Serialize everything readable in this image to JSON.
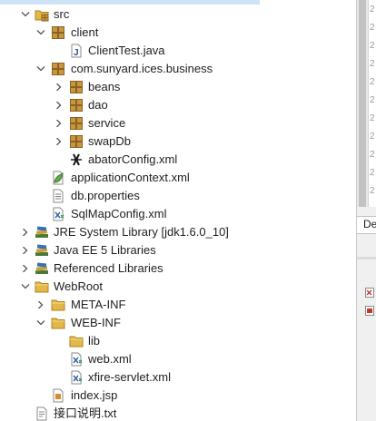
{
  "explorer": {
    "items": [
      {
        "label": "src",
        "depth": 1,
        "icon": "source-folder-icon",
        "expanded": true
      },
      {
        "label": "client",
        "depth": 2,
        "icon": "package-icon",
        "expanded": true
      },
      {
        "label": "ClientTest.java",
        "depth": 3,
        "icon": "java-file-icon"
      },
      {
        "label": "com.sunyard.ices.business",
        "depth": 2,
        "icon": "package-icon",
        "expanded": true
      },
      {
        "label": "beans",
        "depth": 3,
        "icon": "package-icon",
        "expanded": false
      },
      {
        "label": "dao",
        "depth": 3,
        "icon": "package-icon",
        "expanded": false
      },
      {
        "label": "service",
        "depth": 3,
        "icon": "package-icon",
        "expanded": false
      },
      {
        "label": "swapDb",
        "depth": 3,
        "icon": "package-icon",
        "expanded": false
      },
      {
        "label": "abatorConfig.xml",
        "depth": 3,
        "icon": "abator-xml-icon"
      },
      {
        "label": "applicationContext.xml",
        "depth": 2,
        "icon": "spring-xml-icon"
      },
      {
        "label": "db.properties",
        "depth": 2,
        "icon": "properties-file-icon"
      },
      {
        "label": "SqlMapConfig.xml",
        "depth": 2,
        "icon": "xml-file-icon"
      },
      {
        "label": "JRE System Library [jdk1.6.0_10]",
        "depth": 1,
        "icon": "library-icon",
        "expanded": false
      },
      {
        "label": "Java EE 5 Libraries",
        "depth": 1,
        "icon": "library-icon",
        "expanded": false
      },
      {
        "label": "Referenced Libraries",
        "depth": 1,
        "icon": "library-icon",
        "expanded": false
      },
      {
        "label": "WebRoot",
        "depth": 1,
        "icon": "folder-icon",
        "expanded": true
      },
      {
        "label": "META-INF",
        "depth": 2,
        "icon": "folder-icon",
        "expanded": false
      },
      {
        "label": "WEB-INF",
        "depth": 2,
        "icon": "folder-icon",
        "expanded": true
      },
      {
        "label": "lib",
        "depth": 3,
        "icon": "folder-icon"
      },
      {
        "label": "web.xml",
        "depth": 3,
        "icon": "xml-file-icon"
      },
      {
        "label": "xfire-servlet.xml",
        "depth": 3,
        "icon": "xml-file-icon"
      },
      {
        "label": "index.jsp",
        "depth": 2,
        "icon": "jsp-file-icon"
      },
      {
        "label": "接口说明.txt",
        "depth": 1,
        "icon": "text-file-icon"
      }
    ]
  },
  "side_panel": {
    "tab_label": "De"
  },
  "colors": {
    "package": "#c8963e",
    "folder": "#e2b84a",
    "library": "#4a7a3a",
    "selection": "#cfe3f7"
  }
}
